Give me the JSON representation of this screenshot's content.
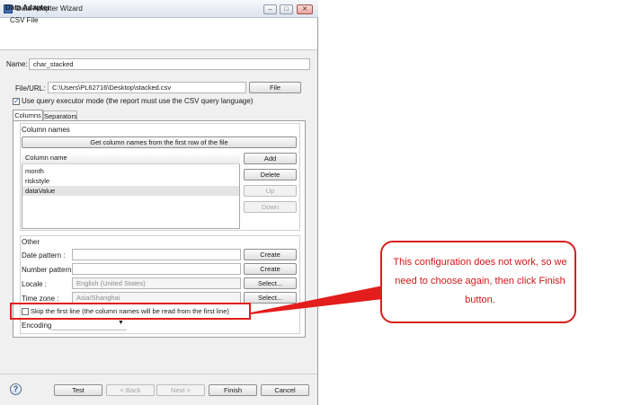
{
  "window": {
    "title": "Data Adapter Wizard",
    "buttons": {
      "minimize": "–",
      "maximize": "□",
      "close": "✕"
    }
  },
  "header": {
    "title": "Data Adapter",
    "subtitle": "CSV File"
  },
  "form": {
    "name_label": "Name:",
    "name_value": "char_stacked",
    "file_label": "File/URL:",
    "file_value": "C:\\Users\\PL62716\\Desktop\\stacked.csv",
    "file_button": "File",
    "query_mode_label": "Use query executor mode (the report must use the CSV query language)",
    "query_mode_checked": true
  },
  "tabs": [
    "Columns",
    "Separators"
  ],
  "column_names": {
    "group_label": "Column names",
    "get_button": "Get column names from the first row of the file",
    "table_header": "Column name",
    "rows": [
      "month",
      "riskstyle",
      "dataValue"
    ],
    "buttons": {
      "add": "Add",
      "delete": "Delete",
      "up": "Up",
      "down": "Down"
    }
  },
  "other": {
    "group_label": "Other",
    "date_pattern_label": "Date pattern :",
    "date_pattern_value": "",
    "number_pattern_label": "Number pattern :",
    "number_pattern_value": "",
    "locale_label": "Locale :",
    "locale_value": "English (United States)",
    "timezone_label": "Time zone :",
    "timezone_value": "Asia/Shanghai",
    "create_label": "Create",
    "select_label": "Select...",
    "skip_first_line_label": "Skip the first line (the column names will be read from the first line)",
    "skip_first_line_checked": false,
    "encoding_label": "Encoding"
  },
  "footer": {
    "help": "?",
    "test": "Test",
    "back": "< Back",
    "next": "Next >",
    "finish": "Finish",
    "cancel": "Cancel"
  },
  "annotation": {
    "callout_text": "This configuration does not work, so we need to choose again, then click Finish button.",
    "color": "#e31c1c"
  }
}
